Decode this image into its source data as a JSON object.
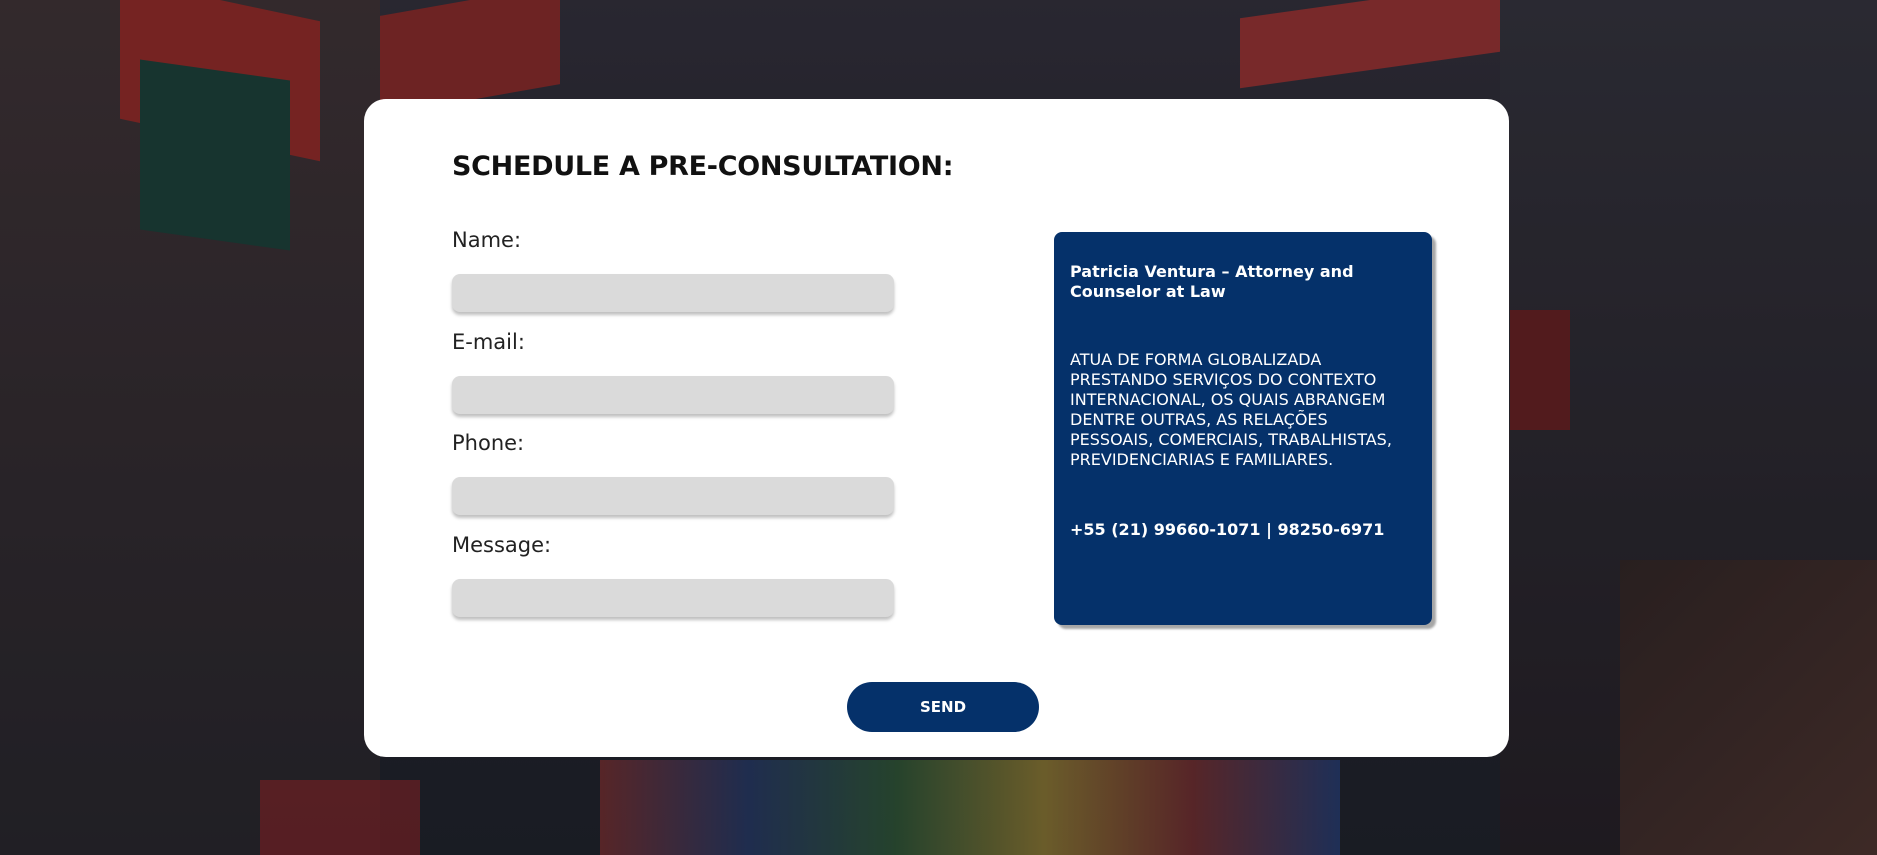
{
  "form": {
    "title": "SCHEDULE A PRE-CONSULTATION:",
    "fields": [
      {
        "label": "Name:",
        "value": "",
        "placeholder": ""
      },
      {
        "label": "E-mail:",
        "value": "",
        "placeholder": ""
      },
      {
        "label": "Phone:",
        "value": "",
        "placeholder": ""
      },
      {
        "label": "Message:",
        "value": "",
        "placeholder": ""
      }
    ],
    "send_label": "SEND"
  },
  "info": {
    "name": "Patricia Ventura – Attorney and Counselor at Law",
    "description": "ATUA DE FORMA GLOBALIZADA PRESTANDO SERVIÇOS DO CONTEXTO INTERNACIONAL, OS QUAIS ABRANGEM DENTRE OUTRAS, AS RELAÇÕES PESSOAIS, COMERCIAIS, TRABALHISTAS, PREVIDENCIARIAS E FAMILIARES.",
    "phone": "+55 (21) 99660-1071 | 98250-6971"
  },
  "colors": {
    "accent": "#05316a",
    "input_bg": "#dadada",
    "card_bg": "#ffffff"
  }
}
